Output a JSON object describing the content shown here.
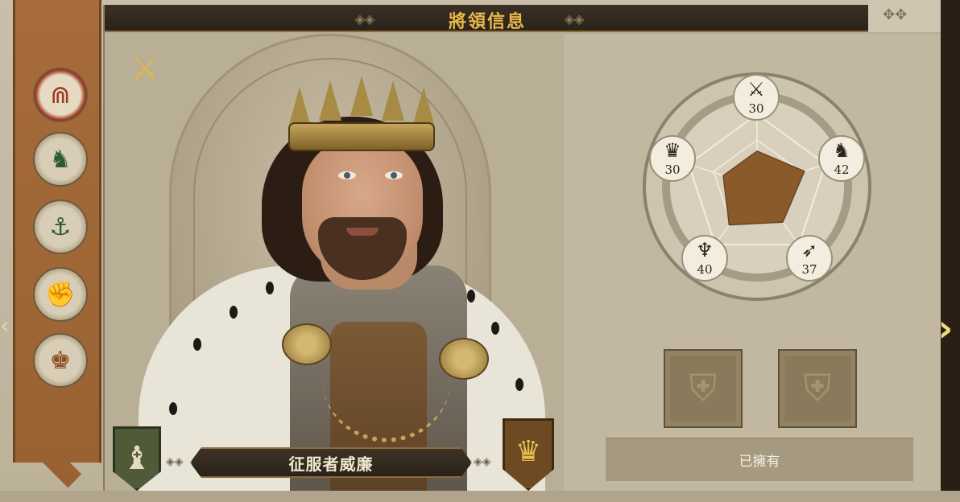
{
  "header": {
    "title": "將領信息"
  },
  "sidebar": {
    "items": [
      {
        "name": "sidebar-item-magnet",
        "icon": "magnet-icon",
        "glyph": "⋒",
        "active": true
      },
      {
        "name": "sidebar-item-cavalry",
        "icon": "knight-horse-icon",
        "glyph": "♞",
        "active": false
      },
      {
        "name": "sidebar-item-navy",
        "icon": "anchor-icon",
        "glyph": "⚓",
        "active": false
      },
      {
        "name": "sidebar-item-strength",
        "icon": "fist-icon",
        "glyph": "✊",
        "active": false
      },
      {
        "name": "sidebar-item-economy",
        "icon": "hand-money-icon",
        "glyph": "♚",
        "active": false
      }
    ]
  },
  "hero": {
    "name": "征服者威廉",
    "class_icon": "crossed-swords-shield-icon",
    "left_badge_icon": "chess-bishop-icon",
    "right_badge_icon": "crown-icon"
  },
  "stats": {
    "top": {
      "icon": "swords-icon",
      "glyph": "⚔",
      "value": "30"
    },
    "upper_right": {
      "icon": "knight-icon",
      "glyph": "♞",
      "value": "42"
    },
    "lower_right": {
      "icon": "bow-icon",
      "glyph": "➶",
      "value": "37"
    },
    "lower_left": {
      "icon": "eagle-icon",
      "glyph": "♆",
      "value": "40"
    },
    "upper_left": {
      "icon": "crown-icon",
      "glyph": "♛",
      "value": "30"
    }
  },
  "equipment": {
    "slots": [
      {
        "icon": "shield-sword-icon",
        "glyph": "⛨"
      },
      {
        "icon": "shield-sword-icon",
        "glyph": "⛨"
      }
    ],
    "owned_label": "已擁有"
  },
  "colors": {
    "title_gold": "#e8b84a",
    "radar_fill": "#8a5a2b",
    "sidebar_brown": "#a66c3a"
  }
}
